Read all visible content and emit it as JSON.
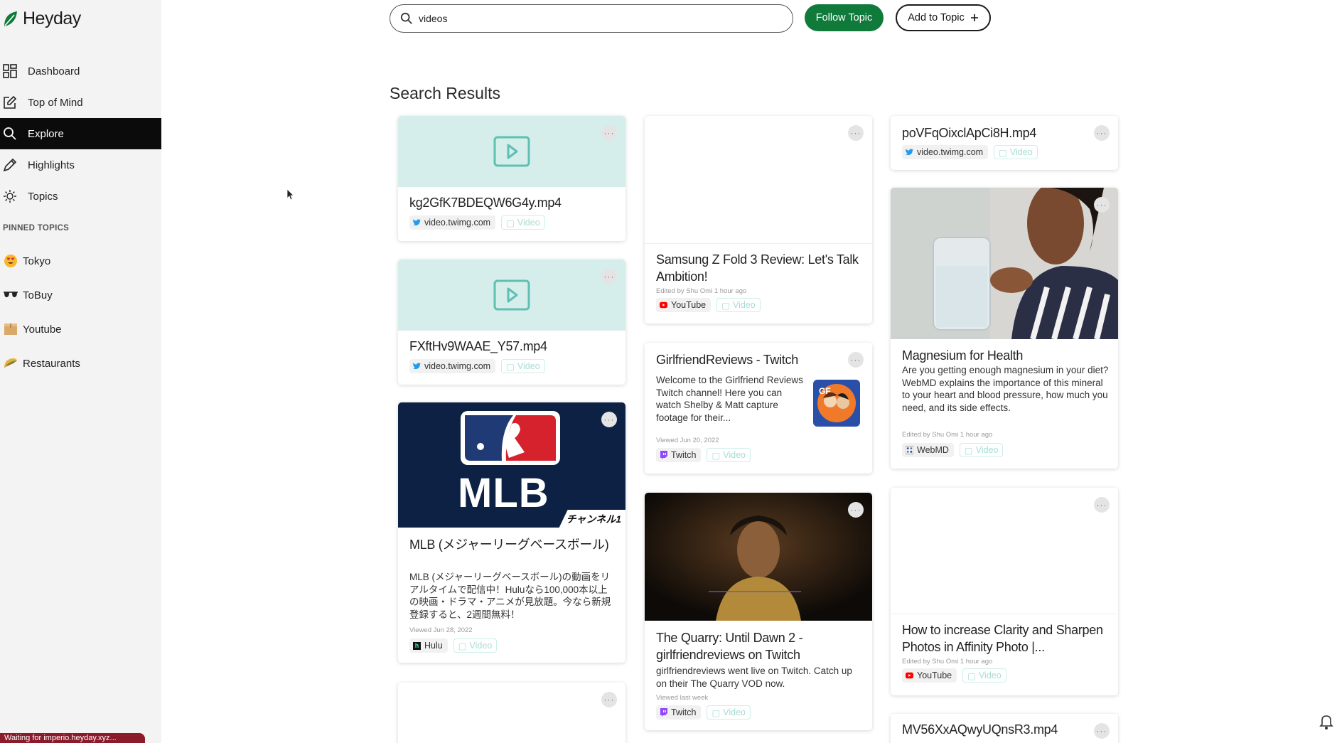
{
  "app": {
    "name": "Heyday"
  },
  "sidebar": {
    "nav": [
      {
        "label": "Dashboard",
        "icon": "grid-icon"
      },
      {
        "label": "Top of Mind",
        "icon": "edit-icon"
      },
      {
        "label": "Explore",
        "icon": "search-icon",
        "active": true
      },
      {
        "label": "Highlights",
        "icon": "pen-icon"
      },
      {
        "label": "Topics",
        "icon": "sun-icon"
      }
    ],
    "pinned_header": "PINNED TOPICS",
    "pinned": [
      {
        "label": "Tokyo",
        "icon": "heart-eyes-emoji-icon"
      },
      {
        "label": "ToBuy",
        "icon": "sunglasses-icon"
      },
      {
        "label": "Youtube",
        "icon": "box-icon"
      },
      {
        "label": "Restaurants",
        "icon": "taco-icon"
      }
    ]
  },
  "status": "Waiting for imperio.heyday.xyz...",
  "search": {
    "value": "videos",
    "placeholder": ""
  },
  "buttons": {
    "follow": "Follow Topic",
    "add": "Add to Topic"
  },
  "section_title": "Search Results",
  "colors": {
    "brand_green": "#0f7a3a",
    "active_nav": "#0b0b0b",
    "video_thumb": "#d5eeeb",
    "status_bar": "#8b1a2b"
  },
  "cards": {
    "c1": {
      "title": "kg2GfK7BDEQW6G4y.mp4",
      "source": "video.twimg.com",
      "type": "Video"
    },
    "c2": {
      "title": "FXftHv9WAAE_Y57.mp4",
      "source": "video.twimg.com",
      "type": "Video"
    },
    "c3": {
      "title": "MLB (メジャーリーグベースボール)",
      "desc": "MLB (メジャーリーグベースボール)の動画をリアルタイムで配信中！Huluなら100,000本以上の映画・ドラマ・アニメが見放題。今なら新規登録すると、2週間無料！",
      "meta": "Viewed Jun 28, 2022",
      "source": "Hulu",
      "type": "Video",
      "thumb_logo": "MLB",
      "thumb_badge": "チャンネル1"
    },
    "c5": {
      "title": "Samsung Z Fold 3 Review: Let's Talk Ambition!",
      "meta": "Edited by Shu Omi 1 hour ago",
      "source": "YouTube",
      "type": "Video"
    },
    "c6": {
      "title": "GirlfriendReviews - Twitch",
      "desc": "Welcome to the Girlfriend Reviews Twitch channel! Here you can watch Shelby & Matt capture footage for their...",
      "meta": "Viewed Jun 20, 2022",
      "source": "Twitch",
      "type": "Video"
    },
    "c7": {
      "title": "The Quarry: Until Dawn 2 - girlfriendreviews on Twitch",
      "desc": "girlfriendreviews went live on Twitch. Catch up on their The Quarry VOD now.",
      "meta": "Viewed last week",
      "source": "Twitch",
      "type": "Video"
    },
    "c8": {
      "title": "poVFqOixclApCi8H.mp4",
      "source": "video.twimg.com",
      "type": "Video"
    },
    "c9": {
      "title": "Magnesium for Health",
      "desc": "Are you getting enough magnesium in your diet? WebMD explains the importance of this mineral to your heart and blood pressure, how much you need, and its side effects.",
      "meta": "Edited by Shu Omi 1 hour ago",
      "source": "WebMD",
      "type": "Video"
    },
    "c10": {
      "title": "How to increase Clarity and Sharpen Photos in Affinity Photo |...",
      "meta": "Edited by Shu Omi 1 hour ago",
      "source": "YouTube",
      "type": "Video"
    },
    "c11": {
      "title": "MV56XxAQwyUQnsR3.mp4"
    }
  }
}
